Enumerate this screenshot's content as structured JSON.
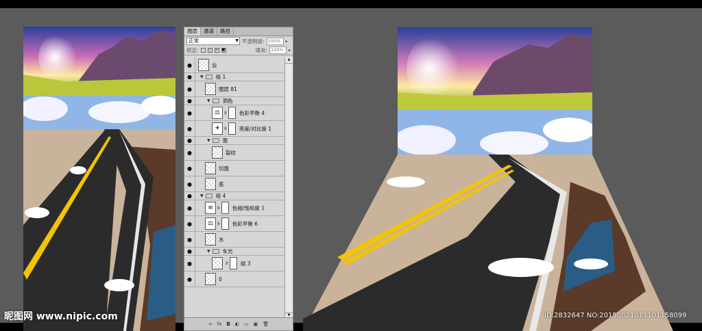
{
  "panel": {
    "tabs": [
      "图层",
      "通道",
      "路径"
    ],
    "active_tab": "图层",
    "blend_mode": "正常",
    "opacity_label": "不透明度:",
    "opacity_value": "100%",
    "lock_label": "锁定:",
    "fill_label": "填充:",
    "fill_value": "100%"
  },
  "layers": [
    {
      "name": "云",
      "kind": "layer",
      "depth": 0
    },
    {
      "name": "组 1",
      "kind": "group",
      "depth": 0
    },
    {
      "name": "图层 81",
      "kind": "layer",
      "depth": 1
    },
    {
      "name": "调色",
      "kind": "group",
      "depth": 1
    },
    {
      "name": "色彩平衡 4",
      "kind": "adjustment",
      "depth": 2,
      "icon": "balance-icon"
    },
    {
      "name": "亮度/对比度 1",
      "kind": "adjustment",
      "depth": 2,
      "icon": "brightness-icon"
    },
    {
      "name": "面",
      "kind": "group",
      "depth": 1
    },
    {
      "name": "裂纹",
      "kind": "layer",
      "depth": 2
    },
    {
      "name": "切面",
      "kind": "layer",
      "depth": 1
    },
    {
      "name": "底",
      "kind": "layer",
      "depth": 1
    },
    {
      "name": "组 4",
      "kind": "group",
      "depth": 0
    },
    {
      "name": "色相/饱和度 1",
      "kind": "adjustment",
      "depth": 1,
      "icon": "hue-saturation-icon"
    },
    {
      "name": "色彩平衡 6",
      "kind": "adjustment",
      "depth": 1,
      "icon": "balance-icon"
    },
    {
      "name": "水",
      "kind": "layer",
      "depth": 1
    },
    {
      "name": "车光",
      "kind": "group",
      "depth": 1
    },
    {
      "name": "组 3",
      "kind": "layer-masked",
      "depth": 2
    },
    {
      "name": "0",
      "kind": "layer",
      "depth": 1
    }
  ],
  "watermark": {
    "left": "昵图网 www.nipic.com",
    "right": "ID:2832647 NO:20150821011101158099"
  },
  "colors": {
    "background": "#5b5b5b",
    "panel": "#d6d6d6",
    "road": "#2a2a2a",
    "road_line": "#f2c500"
  }
}
